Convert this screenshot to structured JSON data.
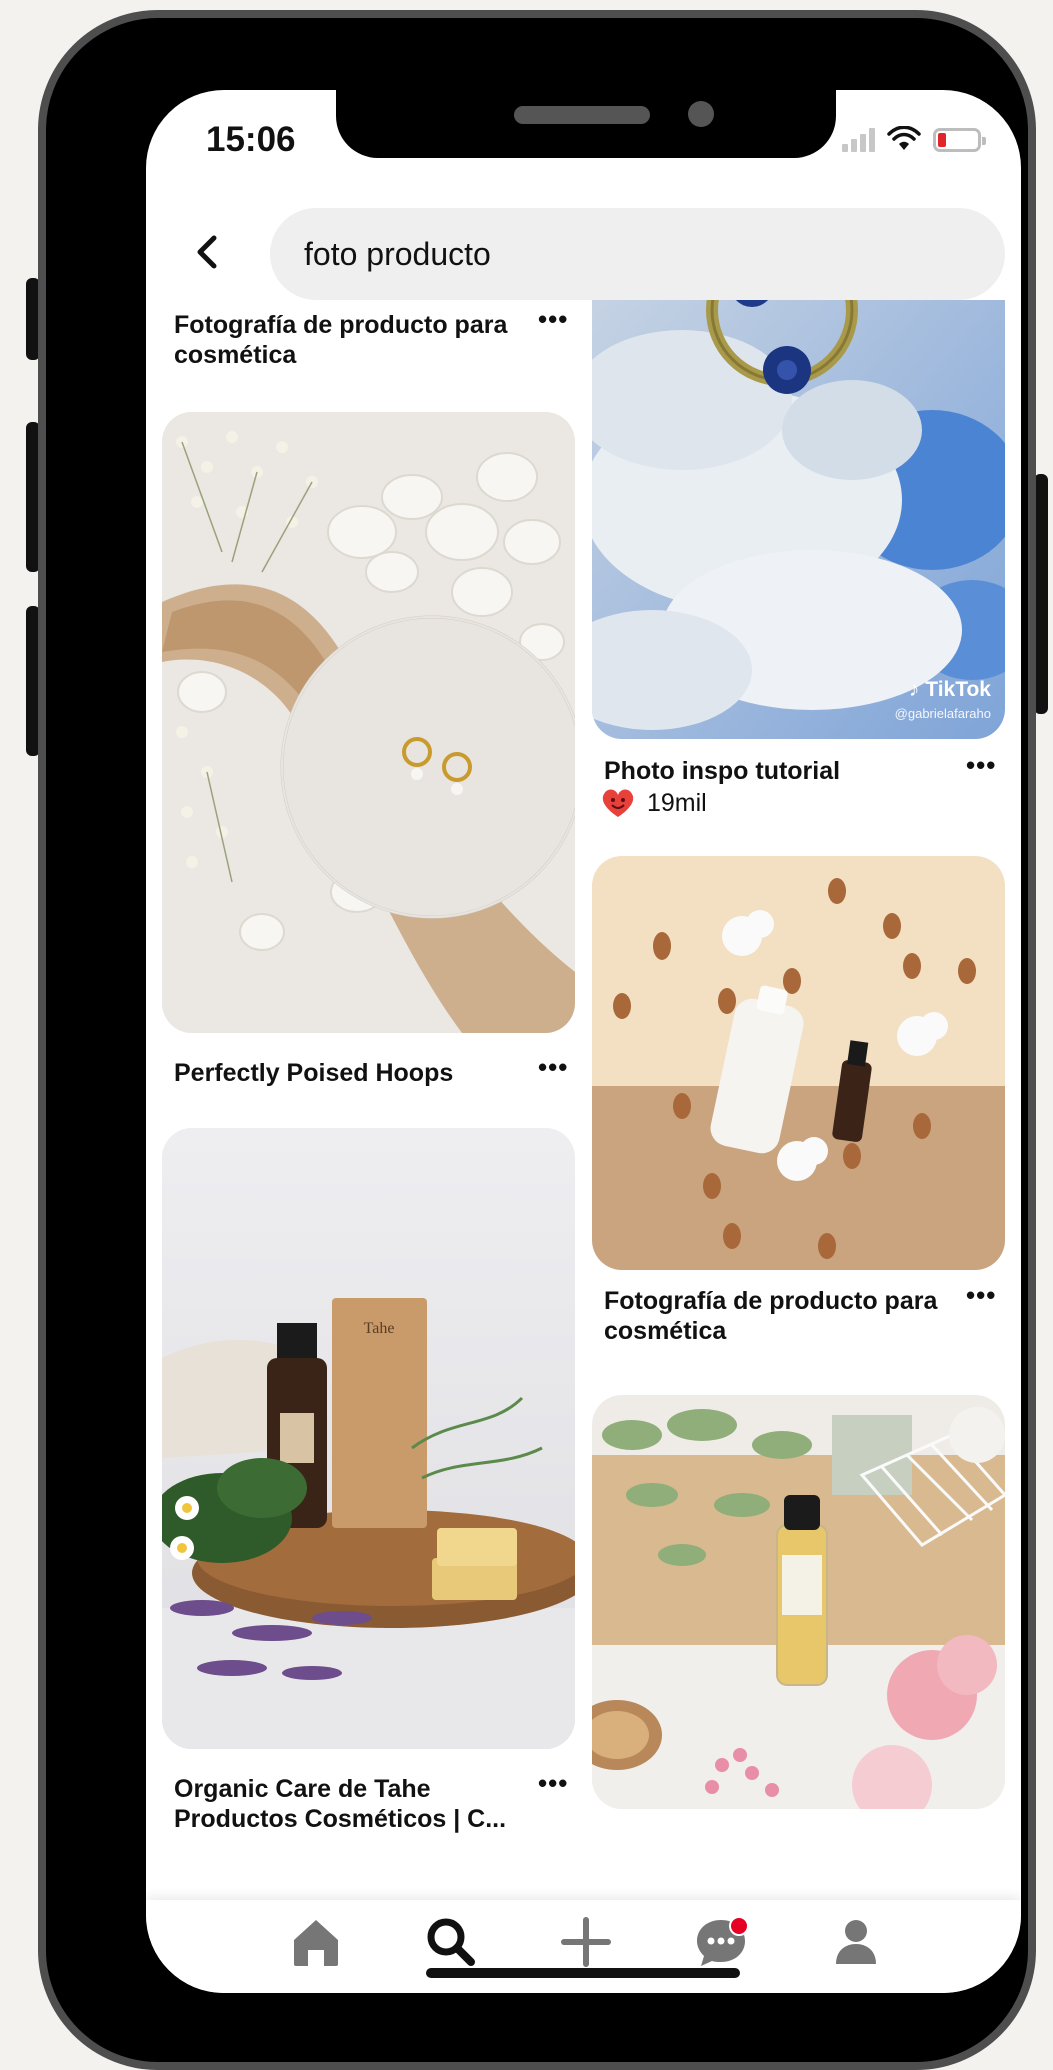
{
  "status_bar": {
    "time": "15:06"
  },
  "search": {
    "query": "foto producto"
  },
  "icons": {
    "back": "chevron-left-icon",
    "home": "home-icon",
    "search": "search-icon",
    "create": "plus-icon",
    "messages": "chat-icon",
    "profile": "profile-icon",
    "more": "more-horizontal-icon",
    "reaction": "heart-face-icon",
    "brand": "tiktok-icon"
  },
  "colors": {
    "accent": "#e60023",
    "reaction": "#e8403a",
    "battery_low": "#e0262b"
  },
  "pins": {
    "cosmetica_top": {
      "title_line1": "Fotografía de producto para",
      "title_line2": "cosmética"
    },
    "hoops": {
      "title": "Perfectly Poised Hoops"
    },
    "tiktok": {
      "title": "Photo inspo tutorial",
      "reactions": "19mil",
      "watermark_brand": "TikTok",
      "watermark_user": "@gabrielafaraho"
    },
    "cosmetica": {
      "title_line1": "Fotografía de producto para",
      "title_line2": "cosmética"
    },
    "tahe": {
      "title_line1": "Organic Care de Tahe",
      "title_line2": "Productos Cosméticos | C..."
    }
  },
  "more_label": "•••"
}
